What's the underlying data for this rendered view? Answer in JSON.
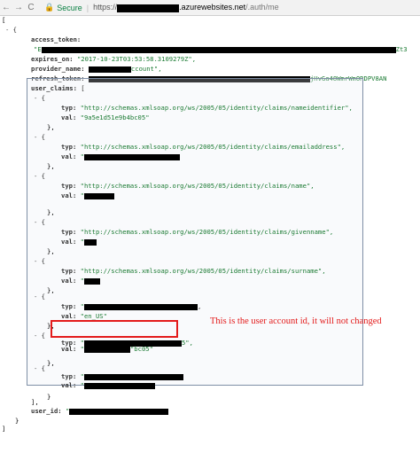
{
  "browser": {
    "back_glyph": "←",
    "forward_glyph": "→",
    "reload_glyph": "C",
    "lock_glyph": "🔒",
    "secure_label": "Secure",
    "url_prefix": "https://",
    "url_domain": ".azurewebsites.net",
    "url_path": "/.auth/me"
  },
  "json": {
    "open_bracket": "[",
    "collapse_glyph": "-",
    "open_brace": "{",
    "access_token_key": "access_token:",
    "access_token_prefix": "\"E",
    "access_token_tail": "Zt3",
    "expires_on_key": "expires_on:",
    "expires_on_value": "\"2017-10-23T03:53:58.3109279Z\",",
    "provider_name_key": "provider_name:",
    "provider_name_value": "ccount\",",
    "refresh_token_key": "refresh_token:",
    "refresh_token_tail": "jHvGa48WmrWmORDPV8AN",
    "user_claims_key": "user_claims:",
    "user_claims_open": "[",
    "claims": [
      {
        "typ": "\"http://schemas.xmlsoap.org/ws/2005/05/identity/claims/nameidentifier\",",
        "val": "\"9a5e1d51e9b4bc05\""
      },
      {
        "typ": "\"http://schemas.xmlsoap.org/ws/2005/05/identity/claims/emailaddress\",",
        "val": "\""
      },
      {
        "typ": "\"http://schemas.xmlsoap.org/ws/2005/05/identity/claims/name\",",
        "val": "\""
      },
      {
        "typ": "\"http://schemas.xmlsoap.org/ws/2005/05/identity/claims/givenname\",",
        "val": "\""
      },
      {
        "typ": "\"http://schemas.xmlsoap.org/ws/2005/05/identity/claims/surname\",",
        "val": "\""
      },
      {
        "typ": "\"",
        "val": "\"en_US\""
      },
      {
        "typ": "\"",
        "val": "\"bc05\"",
        "typ_tail": "5\","
      },
      {
        "typ": "\"",
        "val": "\""
      }
    ],
    "typ_key": "typ:",
    "val_key": "val:",
    "close_brace": "},",
    "close_brace_last": "}",
    "claims_close": "],",
    "user_id_key": "user_id:",
    "user_id_value": "\"",
    "close_brace_final": "}",
    "close_bracket": "]"
  },
  "annotation": {
    "text": "This is the user account id, it will not changed",
    "color": "#e31b1b"
  }
}
